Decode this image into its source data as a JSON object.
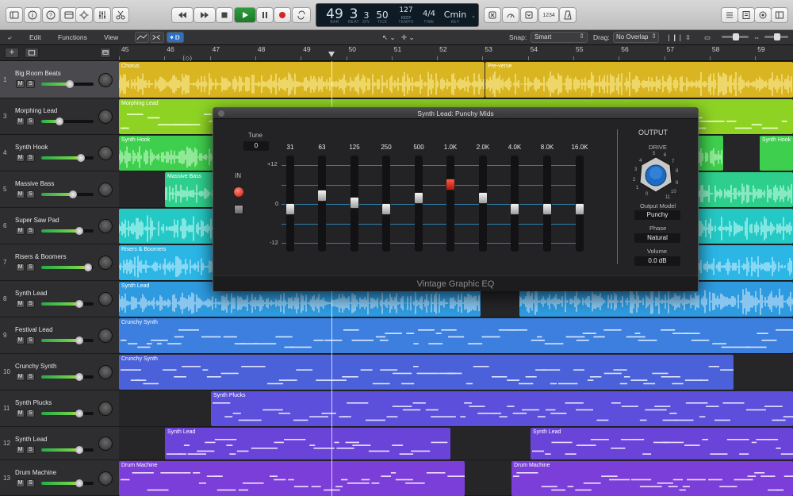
{
  "transport": {
    "bar": "49",
    "beat": "3",
    "div": "3",
    "tick": "50",
    "tempo": "127",
    "tempo_label": "KEEP",
    "timesig": "4/4",
    "key": "Cmin",
    "labels": {
      "bar": "BAR",
      "beat": "BEAT",
      "div": "DIV",
      "tick": "TICK",
      "tempo": "TEMPO",
      "time": "TIME",
      "key": "KEY"
    },
    "countin": "1234"
  },
  "menubar": {
    "edit": "Edit",
    "functions": "Functions",
    "view": "View",
    "snap_label": "Snap:",
    "snap_value": "Smart",
    "drag_label": "Drag:",
    "drag_value": "No Overlap"
  },
  "ruler": [
    "45",
    "46",
    "47",
    "48",
    "49",
    "50",
    "51",
    "52",
    "53",
    "54",
    "55",
    "56",
    "57",
    "58",
    "59"
  ],
  "tracks": [
    {
      "num": "1",
      "name": "Big Room Beats",
      "level": 0.55
    },
    {
      "num": "3",
      "name": "Morphing Lead",
      "level": 0.35
    },
    {
      "num": "4",
      "name": "Synth Hook",
      "level": 0.75
    },
    {
      "num": "5",
      "name": "Massive Bass",
      "level": 0.6
    },
    {
      "num": "6",
      "name": "Super Saw Pad",
      "level": 0.72
    },
    {
      "num": "7",
      "name": "Risers & Boomers",
      "level": 0.9
    },
    {
      "num": "8",
      "name": "Synth Lead",
      "level": 0.72
    },
    {
      "num": "9",
      "name": "Festival Lead",
      "level": 0.72
    },
    {
      "num": "10",
      "name": "Crunchy Synth",
      "level": 0.72
    },
    {
      "num": "11",
      "name": "Synth Plucks",
      "level": 0.72
    },
    {
      "num": "12",
      "name": "Synth Lead",
      "level": 0.72
    },
    {
      "num": "13",
      "name": "Drum Machine",
      "level": 0.72
    }
  ],
  "regions": {
    "chorus": "Chorus",
    "preverse": "Pre-verse",
    "morphing": "Morphing Lead",
    "hook": "Synth Hook",
    "hook2": "Synth Hook",
    "bass": "Massive Bass",
    "risers": "Risers & Boomers",
    "lead": "Synth Lead",
    "crunchy1": "Crunchy Synth",
    "crunchy2": "Crunchy Synth",
    "plucks": "Synth Plucks",
    "lead12a": "Synth Lead",
    "lead12b": "Synth Lead",
    "drum1": "Drum Machine",
    "drum2": "Drum Machine"
  },
  "eq": {
    "title": "Synth Lead: Punchy Mids",
    "tune_label": "Tune",
    "tune_value": "0",
    "in_label": "IN",
    "bands": [
      "31",
      "63",
      "125",
      "250",
      "500",
      "1.0K",
      "2.0K",
      "4.0K",
      "8.0K",
      "16.0K"
    ],
    "scale": {
      "top": "+12",
      "mid": "0",
      "bottom": "-12"
    },
    "output_label": "OUTPUT",
    "drive_label": "DRIVE",
    "drive_marks": [
      "0",
      "1",
      "2",
      "3",
      "4",
      "5",
      "6",
      "7",
      "8",
      "9",
      "10",
      "11"
    ],
    "output_model_label": "Output Model",
    "output_model_value": "Punchy",
    "phase_label": "Phase",
    "phase_value": "Natural",
    "volume_label": "Volume",
    "volume_value": "0.0 dB",
    "footer": "Vintage Graphic EQ"
  },
  "colors": {
    "yellow": "#d9b521",
    "lime": "#8ed324",
    "green": "#3fcf4e",
    "mint": "#2ecf8d",
    "teal": "#24c8c4",
    "cyan": "#2bb6e6",
    "lightblue": "#2e9be0",
    "blue": "#3c7fdf",
    "indigo": "#4a61d9",
    "violet": "#5b4fdb",
    "purple": "#6a43d9",
    "grape": "#7c3ed8"
  }
}
